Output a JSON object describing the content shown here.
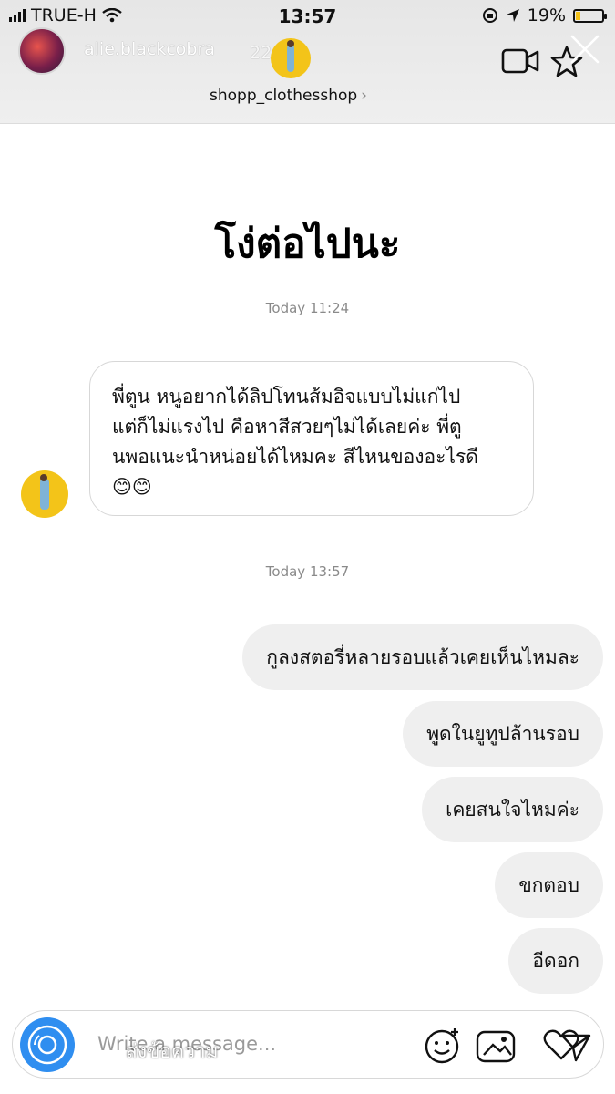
{
  "status_bar": {
    "carrier": "TRUE-H",
    "time": "13:57",
    "battery": "19%",
    "battery_level": 0.19
  },
  "header": {
    "username": "alie.blackcobra",
    "time_ago": "22ชม.",
    "shop_name": "shopp_clothesshop",
    "icons": [
      "video-camera-icon",
      "star-icon",
      "close-icon"
    ]
  },
  "story": {
    "headline": "โง่ต่อไปนะ"
  },
  "conversation": {
    "timestamp_1": "Today 11:24",
    "incoming_message": {
      "line1": "พี่ตูน หนูอยากได้ลิปโทนส้มอิจแบบไม่แก่ไป",
      "line2": "แต่ก็ไม่แรงไป คือหาสีสวยๆไม่ได้เลยค่ะ พี่ตู",
      "line3": "นพอแนะนำหน่อยได้ไหมคะ สีไหนของอะไรดี",
      "emojis": "😊😊"
    },
    "timestamp_2": "Today 13:57",
    "outgoing": [
      "กูลงสตอรี่หลายรอบแล้วเคยเห็นไหมละ",
      "พูดในยูทูปล้านรอบ",
      "เคยสนใจไหมค่ะ",
      "ขกตอบ",
      "อีดอก"
    ]
  },
  "composer": {
    "placeholder": "Write a message...",
    "overlay_text": "ส่งข้อความ",
    "icons": [
      "camera-icon",
      "emoji-sticker-icon",
      "photo-icon",
      "heart-icon",
      "send-icon"
    ],
    "accent_color": "#2f8ef0"
  }
}
